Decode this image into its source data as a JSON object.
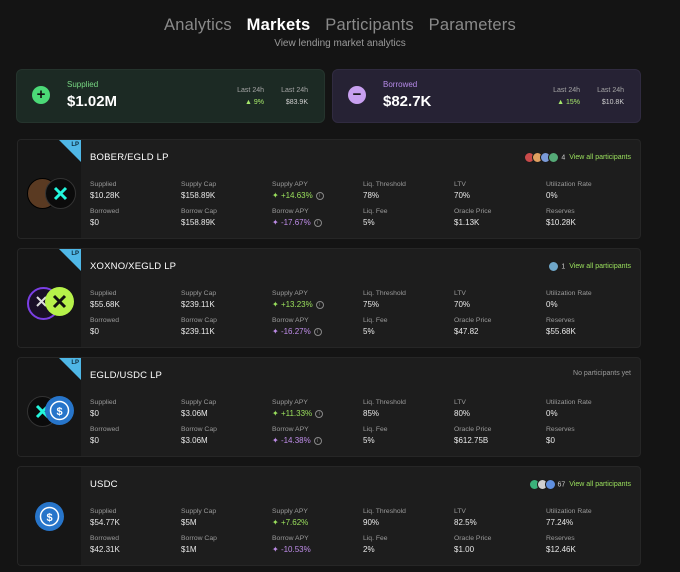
{
  "nav": {
    "tabs": [
      {
        "label": "Analytics"
      },
      {
        "label": "Markets"
      },
      {
        "label": "Participants"
      },
      {
        "label": "Parameters"
      }
    ],
    "subtitle": "View lending market analytics"
  },
  "summary": {
    "supplied": {
      "label": "Supplied",
      "value": "$1.02M",
      "col1_label": "Last 24h",
      "col1_value": "9%",
      "col2_label": "Last 24h",
      "col2_value": "$83.9K",
      "icon": "plus-icon"
    },
    "borrowed": {
      "label": "Borrowed",
      "value": "$82.7K",
      "col1_label": "Last 24h",
      "col1_value": "15%",
      "col2_label": "Last 24h",
      "col2_value": "$10.8K",
      "icon": "minus-icon"
    }
  },
  "labels": {
    "supplied": "Supplied",
    "supply_cap": "Supply Cap",
    "supply_apy": "Supply APY",
    "liq_threshold": "Liq. Threshold",
    "ltv": "LTV",
    "utilization": "Utilization Rate",
    "borrowed": "Borrowed",
    "borrow_cap": "Borrow Cap",
    "borrow_apy": "Borrow APY",
    "liq_fee": "Liq. Fee",
    "oracle": "Oracle Price",
    "reserves": "Reserves",
    "view_all": "View all participants",
    "no_participants": "No participants yet"
  },
  "markets": [
    {
      "name": "BOBER/EGLD LP",
      "lp": true,
      "participants_count": "4",
      "supplied": "$10.28K",
      "supply_cap": "$158.89K",
      "supply_apy": "+14.63%",
      "liq_threshold": "78%",
      "ltv": "70%",
      "utilization": "0%",
      "borrowed": "$0",
      "borrow_cap": "$158.89K",
      "borrow_apy": "-17.67%",
      "liq_fee": "5%",
      "oracle": "$1.13K",
      "reserves": "$10.28K"
    },
    {
      "name": "XOXNO/XEGLD LP",
      "lp": true,
      "participants_count": "1",
      "supplied": "$55.68K",
      "supply_cap": "$239.11K",
      "supply_apy": "+13.23%",
      "liq_threshold": "75%",
      "ltv": "70%",
      "utilization": "0%",
      "borrowed": "$0",
      "borrow_cap": "$239.11K",
      "borrow_apy": "-16.27%",
      "liq_fee": "5%",
      "oracle": "$47.82",
      "reserves": "$55.68K"
    },
    {
      "name": "EGLD/USDC LP",
      "lp": true,
      "participants_count": "",
      "supplied": "$0",
      "supply_cap": "$3.06M",
      "supply_apy": "+11.33%",
      "liq_threshold": "85%",
      "ltv": "80%",
      "utilization": "0%",
      "borrowed": "$0",
      "borrow_cap": "$3.06M",
      "borrow_apy": "-14.38%",
      "liq_fee": "5%",
      "oracle": "$612.75B",
      "reserves": "$0"
    },
    {
      "name": "USDC",
      "lp": false,
      "participants_count": "67",
      "supplied": "$54.77K",
      "supply_cap": "$5M",
      "supply_apy": "+7.62%",
      "liq_threshold": "90%",
      "ltv": "82.5%",
      "utilization": "77.24%",
      "borrowed": "$42.31K",
      "borrow_cap": "$1M",
      "borrow_apy": "-10.53%",
      "liq_fee": "2%",
      "oracle": "$1.00",
      "reserves": "$12.46K"
    }
  ],
  "colors": {
    "accent_green": "#9be15d",
    "accent_purple": "#bf8de9",
    "lp_badge": "#4fb7e6"
  }
}
